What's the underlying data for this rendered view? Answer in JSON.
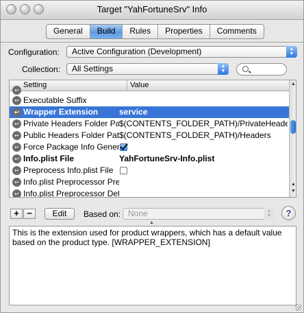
{
  "window": {
    "title": "Target \"YahFortuneSrv\" Info",
    "ghost_title": "..."
  },
  "tabs": [
    {
      "label": "General",
      "active": false
    },
    {
      "label": "Build",
      "active": true
    },
    {
      "label": "Rules",
      "active": false
    },
    {
      "label": "Properties",
      "active": false
    },
    {
      "label": "Comments",
      "active": false
    }
  ],
  "configuration": {
    "label": "Configuration:",
    "value": "Active Configuration (Development)"
  },
  "collection": {
    "label": "Collection:",
    "value": "All Settings"
  },
  "search": {
    "placeholder": ""
  },
  "table": {
    "headers": {
      "setting": "Setting",
      "value": "Value"
    },
    "rows": [
      {
        "setting": "",
        "value": "",
        "partial": true
      },
      {
        "setting": "Executable Suffix",
        "value": ""
      },
      {
        "setting": "Wrapper Extension",
        "value": "service",
        "selected": true
      },
      {
        "setting": "Private Headers Folder Path",
        "value": "$(CONTENTS_FOLDER_PATH)/PrivateHeaders"
      },
      {
        "setting": "Public Headers Folder Path",
        "value": "$(CONTENTS_FOLDER_PATH)/Headers"
      },
      {
        "setting": "Force Package Info Generation",
        "checkbox": true,
        "checked": true
      },
      {
        "setting": "Info.plist File",
        "value": "YahFortuneSrv-Info.plist",
        "bold": true
      },
      {
        "setting": "Preprocess Info.plist File",
        "checkbox": true,
        "checked": false
      },
      {
        "setting": "Info.plist Preprocessor Prefix File",
        "value": ""
      },
      {
        "setting": "Info.plist Preprocessor Definitions",
        "value": "",
        "partial": true
      }
    ]
  },
  "buttons": {
    "add": "+",
    "remove": "−",
    "edit": "Edit",
    "help": "?"
  },
  "based_on": {
    "label": "Based on:",
    "value": "None"
  },
  "description": "This is the extension used for product wrappers, which has a default value based on the product type. [WRAPPER_EXTENSION]"
}
